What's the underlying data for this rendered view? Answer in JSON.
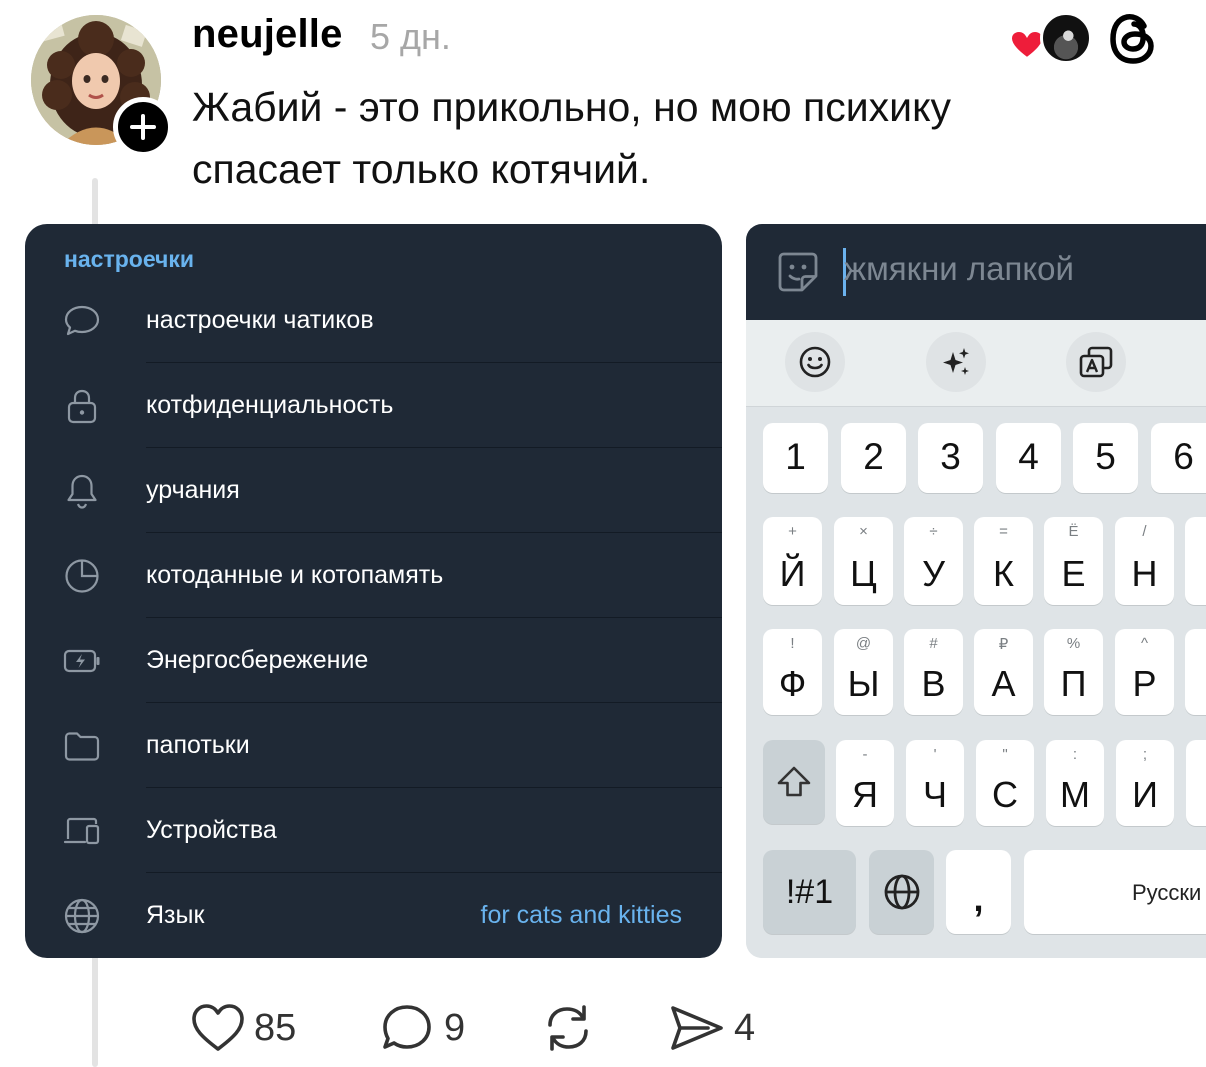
{
  "post": {
    "username": "neujelle",
    "time": "5 дн.",
    "text": "Жабий - это прикольно, но мою психику спасает только котячий."
  },
  "settings": {
    "title": "настроечки",
    "items": [
      {
        "label": "настроечки чатиков",
        "icon": "chat-bubble-icon"
      },
      {
        "label": "котфиденциальность",
        "icon": "lock-icon"
      },
      {
        "label": "урчания",
        "icon": "bell-icon"
      },
      {
        "label": "котоданные и котопамять",
        "icon": "pie-chart-icon"
      },
      {
        "label": "Энергосбережение",
        "icon": "battery-icon"
      },
      {
        "label": "папотьки",
        "icon": "folder-icon"
      },
      {
        "label": "Устройства",
        "icon": "devices-icon"
      },
      {
        "label": "Язык",
        "icon": "globe-icon",
        "value": "for cats and kitties"
      }
    ]
  },
  "keyboard": {
    "placeholder": "жмякни лапкой",
    "numbers": [
      "1",
      "2",
      "3",
      "4",
      "5",
      "6"
    ],
    "row1": [
      {
        "main": "Й",
        "sub": "+"
      },
      {
        "main": "Ц",
        "sub": "×"
      },
      {
        "main": "У",
        "sub": "÷"
      },
      {
        "main": "К",
        "sub": "="
      },
      {
        "main": "Е",
        "sub": "Ë"
      },
      {
        "main": "Н",
        "sub": "/"
      }
    ],
    "row2": [
      {
        "main": "Ф",
        "sub": "!"
      },
      {
        "main": "Ы",
        "sub": "@"
      },
      {
        "main": "В",
        "sub": "#"
      },
      {
        "main": "А",
        "sub": "₽"
      },
      {
        "main": "П",
        "sub": "%"
      },
      {
        "main": "Р",
        "sub": "^"
      }
    ],
    "row3": [
      {
        "main": "Я",
        "sub": "-"
      },
      {
        "main": "Ч",
        "sub": "'"
      },
      {
        "main": "С",
        "sub": "\""
      },
      {
        "main": "М",
        "sub": ":"
      },
      {
        "main": "И",
        "sub": ";"
      }
    ],
    "symbols_label": "!#1",
    "comma_label": ",",
    "space_label": "Русски"
  },
  "actions": {
    "likes": "85",
    "comments": "9",
    "shares": "4"
  }
}
